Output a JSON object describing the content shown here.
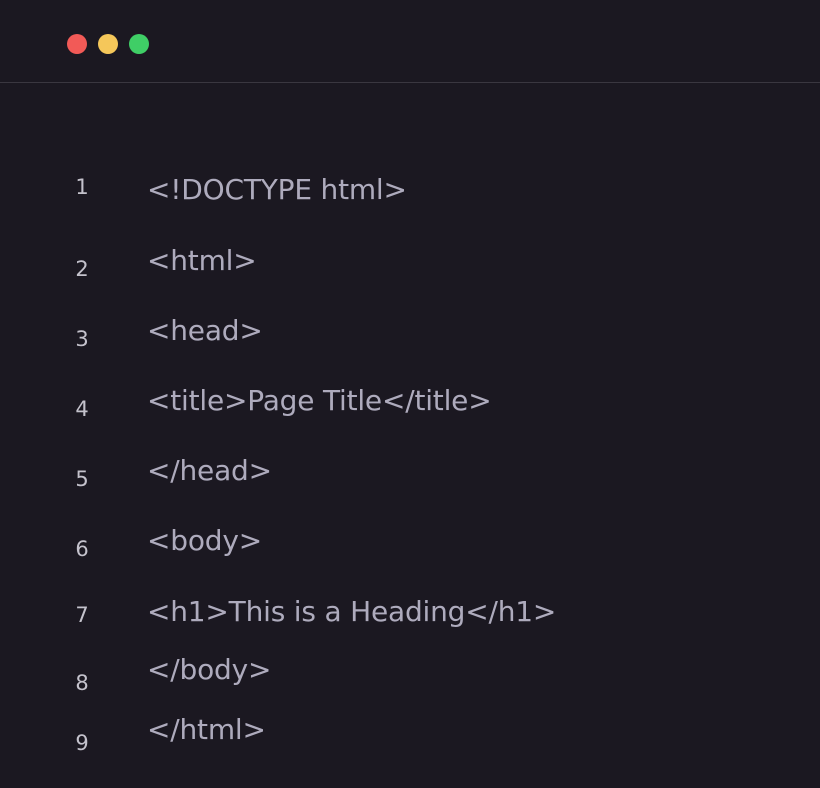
{
  "window": {
    "controls": {
      "close_color": "#f25a57",
      "minimize_color": "#f5c75a",
      "maximize_color": "#3fce66"
    }
  },
  "editor": {
    "lines": [
      {
        "number": "1",
        "text": "<!DOCTYPE html>"
      },
      {
        "number": "2",
        "text": "<html>"
      },
      {
        "number": "3",
        "text": "<head>"
      },
      {
        "number": "4",
        "text": "<title>Page Title</title>"
      },
      {
        "number": "5",
        "text": "</head>"
      },
      {
        "number": "6",
        "text": "<body>"
      },
      {
        "number": "7",
        "text": "<h1>This is a Heading</h1>"
      },
      {
        "number": "8",
        "text": "</body>"
      },
      {
        "number": "9",
        "text": "</html>"
      }
    ]
  }
}
